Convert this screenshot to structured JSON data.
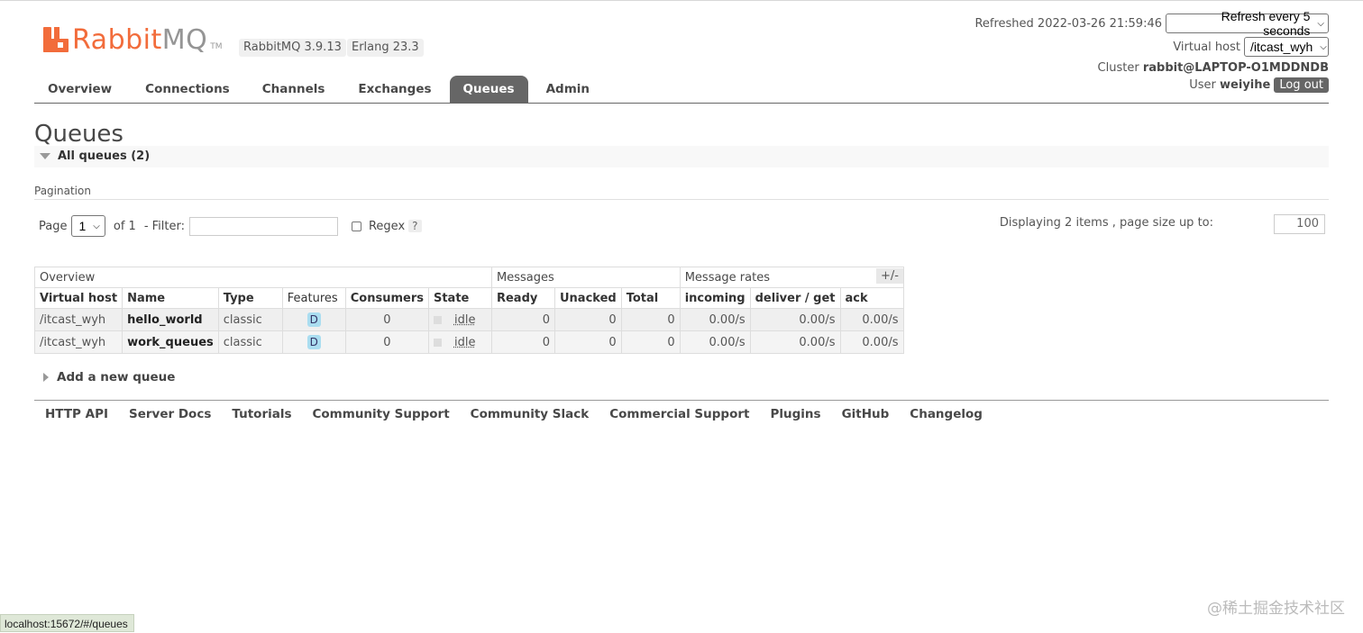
{
  "header": {
    "logo_primary": "Rabbit",
    "logo_secondary": "MQ",
    "logo_tm": "TM",
    "version": "RabbitMQ 3.9.13",
    "erlang": "Erlang 23.3",
    "refreshed_label": "Refreshed 2022-03-26 21:59:46",
    "refresh_select": "Refresh every 5 seconds",
    "vhost_label": "Virtual host",
    "vhost_select": "/itcast_wyh",
    "cluster_label": "Cluster",
    "cluster_value": "rabbit@LAPTOP-O1MDDNDB",
    "user_label": "User",
    "user_value": "weiyihe",
    "logout": "Log out"
  },
  "tabs": [
    "Overview",
    "Connections",
    "Channels",
    "Exchanges",
    "Queues",
    "Admin"
  ],
  "active_tab": "Queues",
  "page_title": "Queues",
  "section_title": "All queues (2)",
  "pagination": {
    "label": "Pagination",
    "page_label": "Page",
    "page_value": "1",
    "of_label": "of 1",
    "filter_label": "- Filter:",
    "filter_value": "",
    "regex_label": "Regex",
    "help": "?",
    "display_info": "Displaying 2 items , page size up to:",
    "page_size": "100"
  },
  "table": {
    "groups": [
      "Overview",
      "Messages",
      "Message rates"
    ],
    "toggle": "+/-",
    "columns": [
      "Virtual host",
      "Name",
      "Type",
      "Features",
      "Consumers",
      "State",
      "Ready",
      "Unacked",
      "Total",
      "incoming",
      "deliver / get",
      "ack"
    ],
    "rows": [
      {
        "vhost": "/itcast_wyh",
        "name": "hello_world",
        "type": "classic",
        "features": "D",
        "consumers": "0",
        "state": "idle",
        "ready": "0",
        "unacked": "0",
        "total": "0",
        "incoming": "0.00/s",
        "deliver": "0.00/s",
        "ack": "0.00/s"
      },
      {
        "vhost": "/itcast_wyh",
        "name": "work_queues",
        "type": "classic",
        "features": "D",
        "consumers": "0",
        "state": "idle",
        "ready": "0",
        "unacked": "0",
        "total": "0",
        "incoming": "0.00/s",
        "deliver": "0.00/s",
        "ack": "0.00/s"
      }
    ]
  },
  "add_queue": "Add a new queue",
  "footer": [
    "HTTP API",
    "Server Docs",
    "Tutorials",
    "Community Support",
    "Community Slack",
    "Commercial Support",
    "Plugins",
    "GitHub",
    "Changelog"
  ],
  "status_url": "localhost:15672/#/queues",
  "watermark": "@稀土掘金技术社区",
  "colors": {
    "brand": "#f26c3b",
    "tab_active": "#666666",
    "feature_badge": "#aaddf0"
  }
}
